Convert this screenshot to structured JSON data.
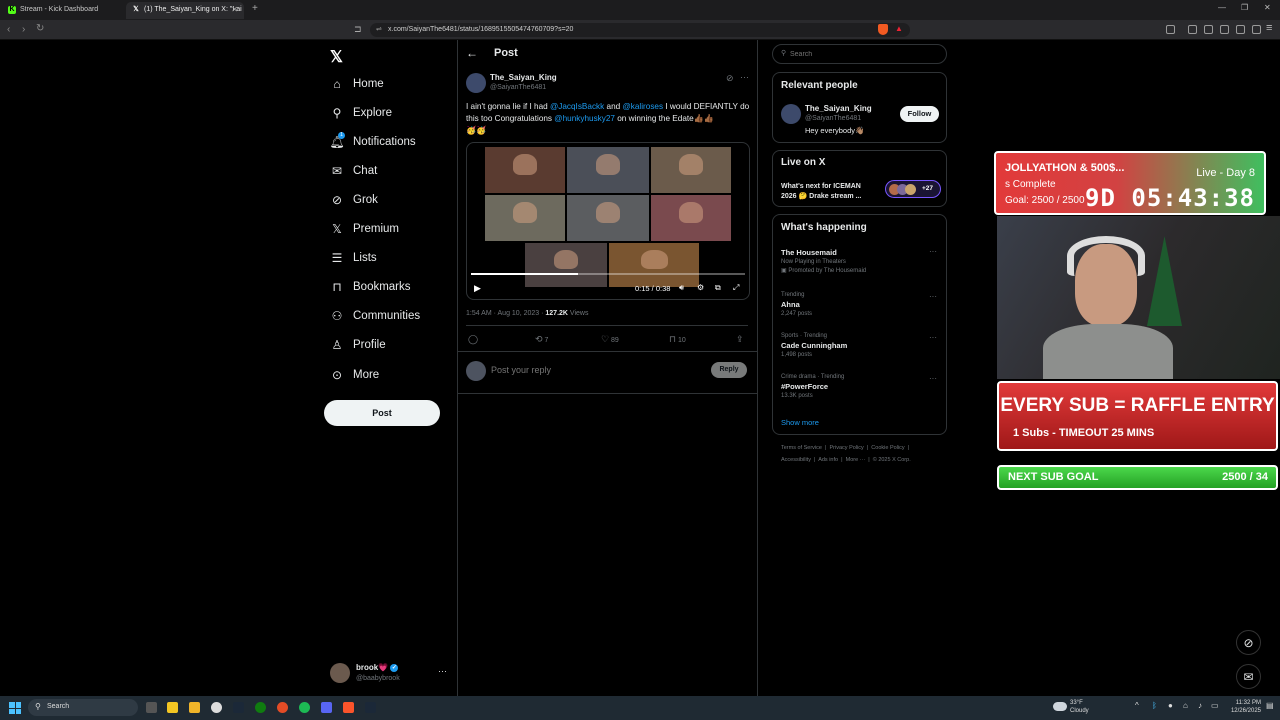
{
  "browser": {
    "tabs": [
      {
        "title": "Stream - Kick Dashboard",
        "icon": "kick-icon",
        "color": "#53fc18"
      },
      {
        "title": "(1) The_Saiyan_King on X: \"I ai",
        "icon": "x-logo-icon",
        "color": "#ffffff"
      }
    ],
    "new_tab": "+",
    "url": "x.com/SaiyanThe6481/status/1689515505474760709?s=20"
  },
  "nav": {
    "items": [
      {
        "label": "Home",
        "icon": "home-icon"
      },
      {
        "label": "Explore",
        "icon": "search-icon"
      },
      {
        "label": "Notifications",
        "icon": "bell-icon",
        "badge": "1"
      },
      {
        "label": "Chat",
        "icon": "mail-icon"
      },
      {
        "label": "Grok",
        "icon": "grok-icon"
      },
      {
        "label": "Premium",
        "icon": "x-premium-icon"
      },
      {
        "label": "Lists",
        "icon": "list-icon"
      },
      {
        "label": "Bookmarks",
        "icon": "bookmark-icon"
      },
      {
        "label": "Communities",
        "icon": "communities-icon"
      },
      {
        "label": "Profile",
        "icon": "person-icon"
      },
      {
        "label": "More",
        "icon": "more-circle-icon"
      }
    ],
    "post_button": "Post",
    "account": {
      "name": "brook",
      "heart": "💗",
      "handle": "@baabybrook",
      "more": "···"
    }
  },
  "post": {
    "header_title": "Post",
    "author_name": "The_Saiyan_King",
    "author_handle": "@SaiyanThe6481",
    "text_1": "I ain't gonna lie if I had ",
    "mention_1": "@JacqIsBackk",
    "text_2": " and ",
    "mention_2": "@kaliroses",
    "text_3": " I would DEFIANTLY do this too Congratulations ",
    "mention_3": "@hunkyhusky27",
    "text_4": " on winning the Edate👍🏾👍🏾",
    "emoji_line": "🥳🥳",
    "video_time": "0:15 / 0:38",
    "video_progress": 0.39,
    "timestamp": "1:54 AM · Aug 10, 2023 · ",
    "views": "127.2K",
    "views_label": " Views",
    "actions": {
      "reposts": "7",
      "likes": "89",
      "bookmarks": "10"
    },
    "reply_placeholder": "Post your reply",
    "reply_button": "Reply"
  },
  "sidebar": {
    "search_placeholder": "Search",
    "relevant_title": "Relevant people",
    "relevant_name": "The_Saiyan_King",
    "relevant_handle": "@SaiyanThe6481",
    "relevant_bio": "Hey everybody👋🏽",
    "follow_button": "Follow",
    "live_title": "Live on X",
    "live_text_1": "What's next for ICEMAN",
    "live_text_2": "2026 🤔 Drake stream ...",
    "live_count": "+27",
    "happening_title": "What's happening",
    "trends": [
      {
        "meta": "",
        "name": "The Housemaid",
        "sub": "Now Playing in Theaters",
        "promo": "Promoted by The Housemaid"
      },
      {
        "meta": "Trending",
        "name": "Ahna",
        "sub": "2,247 posts",
        "promo": ""
      },
      {
        "meta": "Sports · Trending",
        "name": "Cade Cunningham",
        "sub": "1,498 posts",
        "promo": ""
      },
      {
        "meta": "Crime drama · Trending",
        "name": "#PowerForce",
        "sub": "13.3K posts",
        "promo": ""
      }
    ],
    "show_more": "Show more",
    "footer_line_1": [
      "Terms of Service",
      "Privacy Policy",
      "Cookie Policy"
    ],
    "footer_line_2": [
      "Accessibility",
      "Ads info",
      "More ···",
      "© 2025 X Corp."
    ]
  },
  "stream_overlay": {
    "event_title": "JOLLYATHON & 500$...",
    "event_status": "Live - Day 8",
    "event_sub": "s Complete",
    "event_goal": "Goal: 2500 / 2500",
    "event_timer": "9D 05:43:38",
    "raffle_title": "EVERY SUB = RAFFLE ENTRY",
    "raffle_sub": "1 Subs - TIMEOUT 25 MINS",
    "sub_goal_label": "NEXT SUB GOAL",
    "sub_goal_value": "2500 / 34"
  },
  "taskbar": {
    "search": "Search",
    "weather_temp": "33°F",
    "weather_cond": "Cloudy",
    "time": "11:32 PM",
    "date": "12/26/2025"
  }
}
